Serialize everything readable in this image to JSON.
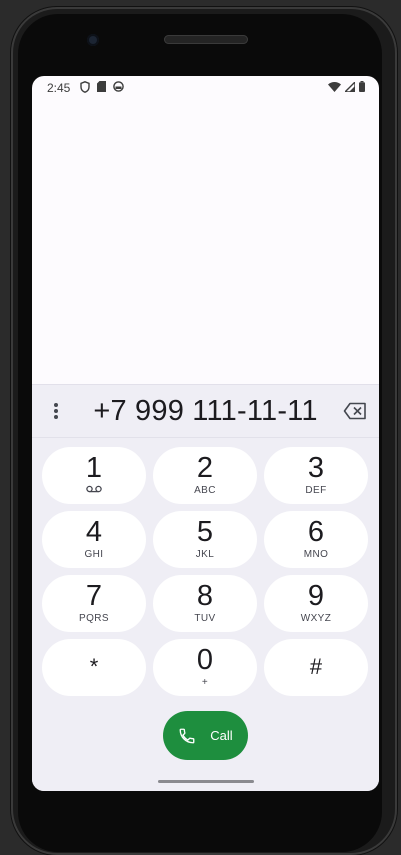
{
  "status_bar": {
    "time": "2:45",
    "icons_left": [
      "shield-icon",
      "sim-card-icon",
      "android-icon"
    ],
    "icons_right": [
      "wifi-icon",
      "signal-icon",
      "battery-icon"
    ]
  },
  "dialer": {
    "dialed_number": "+7 999 111-11-11",
    "keys": [
      {
        "digit": "1",
        "letters": ""
      },
      {
        "digit": "2",
        "letters": "ABC"
      },
      {
        "digit": "3",
        "letters": "DEF"
      },
      {
        "digit": "4",
        "letters": "GHI"
      },
      {
        "digit": "5",
        "letters": "JKL"
      },
      {
        "digit": "6",
        "letters": "MNO"
      },
      {
        "digit": "7",
        "letters": "PQRS"
      },
      {
        "digit": "8",
        "letters": "TUV"
      },
      {
        "digit": "9",
        "letters": "WXYZ"
      },
      {
        "digit": "*",
        "letters": ""
      },
      {
        "digit": "0",
        "letters": "+"
      },
      {
        "digit": "#",
        "letters": ""
      }
    ],
    "call_label": "Call"
  },
  "colors": {
    "call_button": "#1e8e3e",
    "dialpad_background": "#efeef5",
    "key_background": "#ffffff"
  }
}
